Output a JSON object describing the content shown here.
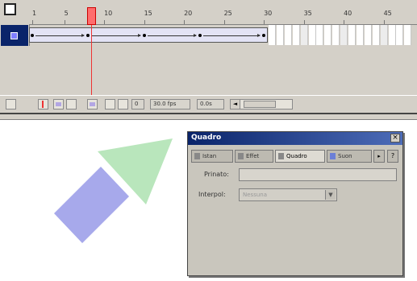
{
  "timeline": {
    "ruler_labels": [
      "1",
      "5",
      "10",
      "15",
      "20",
      "25",
      "30",
      "35",
      "40",
      "45"
    ],
    "current_frame": 10,
    "tween_start_frame": 1,
    "tween_end_frame": 30,
    "layer_color": "#7f7fff"
  },
  "statusbar": {
    "frame": "0",
    "fps": "30.0 fps",
    "time": "0.0s",
    "scroll_left": "◄"
  },
  "panel": {
    "title": "Quadro",
    "close": "×",
    "tabs": [
      "Istan",
      "Effet",
      "Quadro",
      "Suon"
    ],
    "more": "▸",
    "help": "?",
    "bounds_label": "Prinato:",
    "instance_label": "Interpol:",
    "instance_value": "Nessuna",
    "instance_arrow": "▼"
  },
  "stage": {
    "arrow_body_color": "#a7a9eb",
    "arrow_head_color": "#b9e6bc"
  }
}
